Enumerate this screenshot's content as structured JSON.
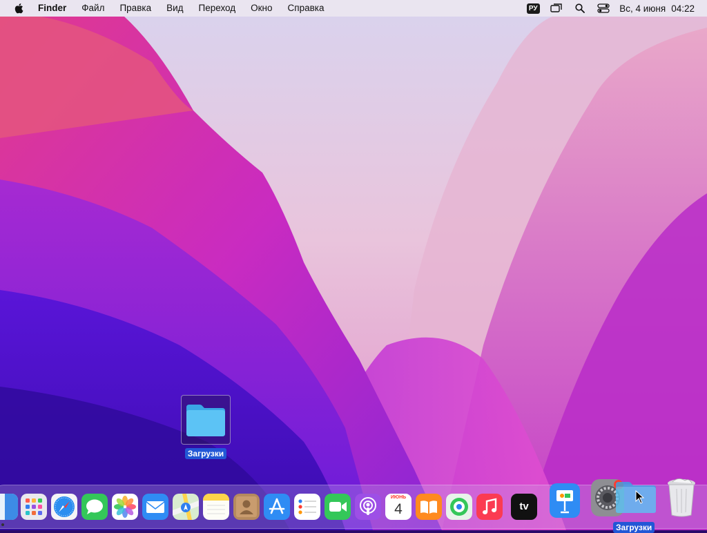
{
  "menubar": {
    "app_name": "Finder",
    "menus": [
      "Файл",
      "Правка",
      "Вид",
      "Переход",
      "Окно",
      "Справка"
    ],
    "input_language": "РУ",
    "date": "Вс, 4 июня",
    "time": "04:22"
  },
  "desktop": {
    "folder_label": "Загрузки"
  },
  "dock": {
    "apps": [
      "finder-icon",
      "launchpad-icon",
      "safari-icon",
      "messages-icon",
      "photos-icon",
      "mail-icon",
      "maps-icon",
      "notes-icon",
      "contacts-icon",
      "app-store-icon",
      "reminders-icon",
      "facetime-icon",
      "podcasts-icon",
      "calendar-icon",
      "books-icon",
      "find-my-icon",
      "music-icon",
      "apple-tv-icon",
      "keynote-icon",
      "system-preferences-icon",
      "trash-icon"
    ],
    "calendar_month": "ИЮНЬ",
    "calendar_day": "4",
    "tv_label": "tv",
    "drag_label": "Загрузки"
  },
  "colors": {
    "selection_blue": "#2257d6",
    "folder_blue": "#5cc3f5"
  }
}
